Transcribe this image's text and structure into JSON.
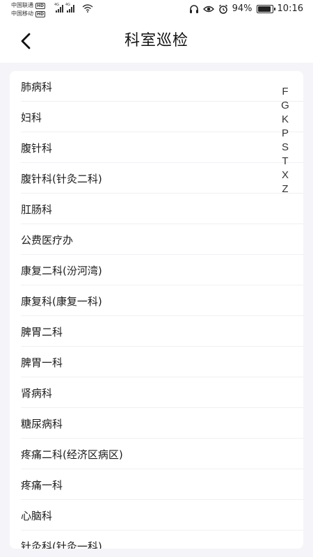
{
  "status_bar": {
    "carrier_1": "中国联通",
    "carrier_2": "中国移动",
    "hd_label": "HD",
    "network_label": "4G",
    "battery": "94%",
    "battery_level": 0.94,
    "time": "10:16",
    "icons": [
      "headset-icon",
      "eye-care-icon",
      "alarm-icon",
      "battery-icon",
      "wifi-icon",
      "signal-icon"
    ]
  },
  "header": {
    "back_icon": "chevron-left-icon",
    "title": "科室巡检"
  },
  "departments": [
    "肺病科",
    "妇科",
    "腹针科",
    "腹针科(针灸二科)",
    "肛肠科",
    "公费医疗办",
    "康复二科(汾河湾)",
    "康复科(康复一科)",
    "脾胃二科",
    "脾胃一科",
    "肾病科",
    "糖尿病科",
    "疼痛二科(经济区病区)",
    "疼痛一科",
    "心脑科",
    "针灸科(针灸一科)"
  ],
  "index_letters": [
    "F",
    "G",
    "K",
    "P",
    "S",
    "T",
    "X",
    "Z"
  ],
  "colors": {
    "background": "#f5f4f8",
    "card": "#ffffff",
    "text": "#1c1c1c",
    "divider": "#f0f0f3"
  }
}
